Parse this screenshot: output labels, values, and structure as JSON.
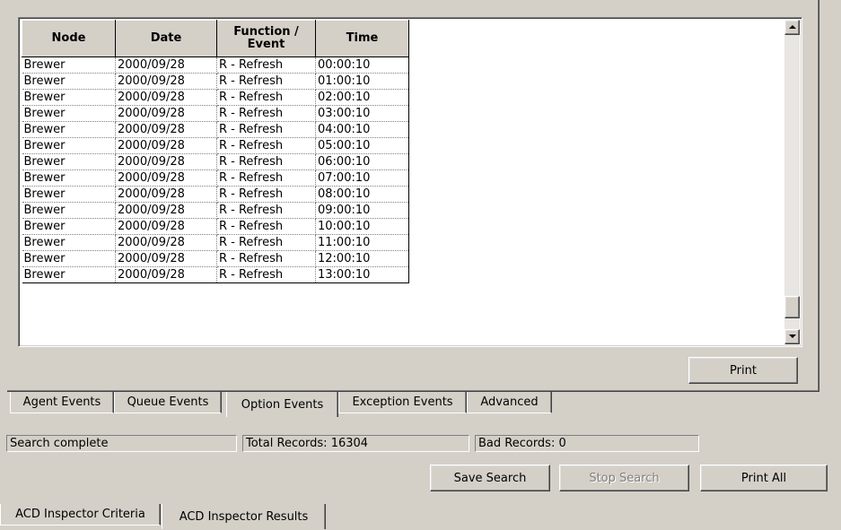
{
  "grid": {
    "columns": [
      "Node",
      "Date",
      "Function /\nEvent",
      "Time"
    ],
    "rows": [
      [
        "Brewer",
        "2000/09/28",
        "R - Refresh",
        "00:00:10"
      ],
      [
        "Brewer",
        "2000/09/28",
        "R - Refresh",
        "01:00:10"
      ],
      [
        "Brewer",
        "2000/09/28",
        "R - Refresh",
        "02:00:10"
      ],
      [
        "Brewer",
        "2000/09/28",
        "R - Refresh",
        "03:00:10"
      ],
      [
        "Brewer",
        "2000/09/28",
        "R - Refresh",
        "04:00:10"
      ],
      [
        "Brewer",
        "2000/09/28",
        "R - Refresh",
        "05:00:10"
      ],
      [
        "Brewer",
        "2000/09/28",
        "R - Refresh",
        "06:00:10"
      ],
      [
        "Brewer",
        "2000/09/28",
        "R - Refresh",
        "07:00:10"
      ],
      [
        "Brewer",
        "2000/09/28",
        "R - Refresh",
        "08:00:10"
      ],
      [
        "Brewer",
        "2000/09/28",
        "R - Refresh",
        "09:00:10"
      ],
      [
        "Brewer",
        "2000/09/28",
        "R - Refresh",
        "10:00:10"
      ],
      [
        "Brewer",
        "2000/09/28",
        "R - Refresh",
        "11:00:10"
      ],
      [
        "Brewer",
        "2000/09/28",
        "R - Refresh",
        "12:00:10"
      ],
      [
        "Brewer",
        "2000/09/28",
        "R - Refresh",
        "13:00:10"
      ]
    ]
  },
  "buttons": {
    "print": "Print",
    "save_search": "Save Search",
    "stop_search": "Stop Search",
    "print_all": "Print All"
  },
  "result_tabs": [
    "Agent Events",
    "Queue Events",
    "Option Events",
    "Exception Events",
    "Advanced"
  ],
  "active_result_tab": "Option Events",
  "status": {
    "message": "Search complete",
    "total_records": "Total Records: 16304",
    "bad_records": "Bad Records: 0"
  },
  "main_tabs": [
    "ACD Inspector Criteria",
    "ACD Inspector Results"
  ],
  "active_main_tab": "ACD Inspector Results",
  "scrollbar": {
    "position_fraction": 0.96
  },
  "icons": {
    "scroll_up": "arrow-up-icon",
    "scroll_down": "arrow-down-icon"
  }
}
